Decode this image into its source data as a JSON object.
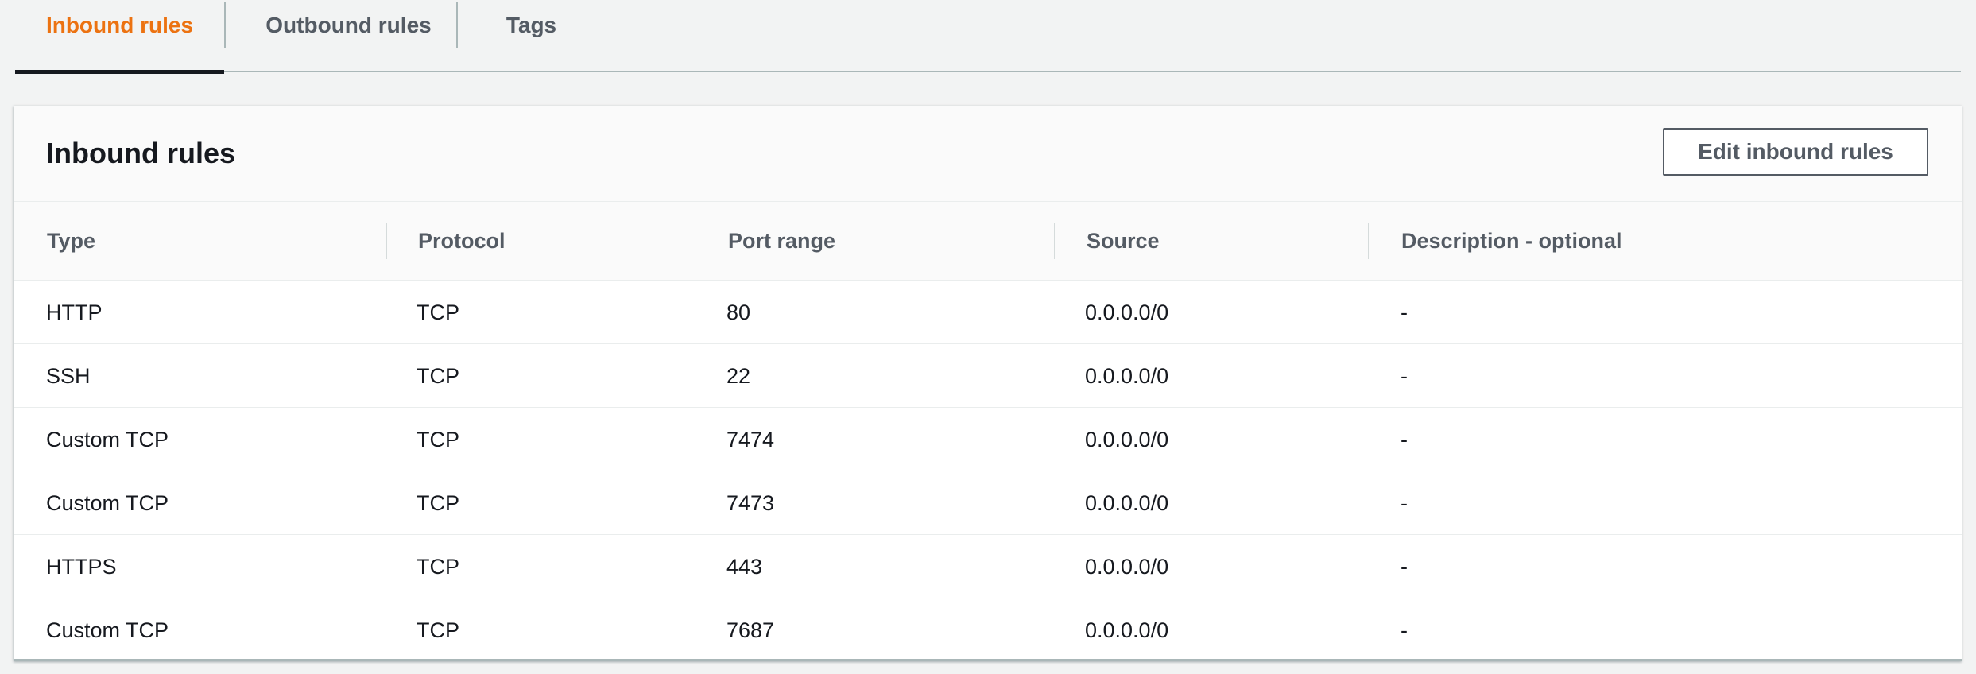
{
  "tabs": [
    {
      "label": "Inbound rules",
      "active": true
    },
    {
      "label": "Outbound rules",
      "active": false
    },
    {
      "label": "Tags",
      "active": false
    }
  ],
  "panel": {
    "title": "Inbound rules",
    "edit_button_label": "Edit inbound rules"
  },
  "table": {
    "columns": [
      "Type",
      "Protocol",
      "Port range",
      "Source",
      "Description - optional"
    ],
    "rows": [
      [
        "HTTP",
        "TCP",
        "80",
        "0.0.0.0/0",
        "-"
      ],
      [
        "SSH",
        "TCP",
        "22",
        "0.0.0.0/0",
        "-"
      ],
      [
        "Custom TCP",
        "TCP",
        "7474",
        "0.0.0.0/0",
        "-"
      ],
      [
        "Custom TCP",
        "TCP",
        "7473",
        "0.0.0.0/0",
        "-"
      ],
      [
        "HTTPS",
        "TCP",
        "443",
        "0.0.0.0/0",
        "-"
      ],
      [
        "Custom TCP",
        "TCP",
        "7687",
        "0.0.0.0/0",
        "-"
      ]
    ]
  },
  "colors": {
    "accent": "#ec7211",
    "text": "#16191f",
    "muted": "#545b64",
    "background": "#f2f3f3"
  }
}
